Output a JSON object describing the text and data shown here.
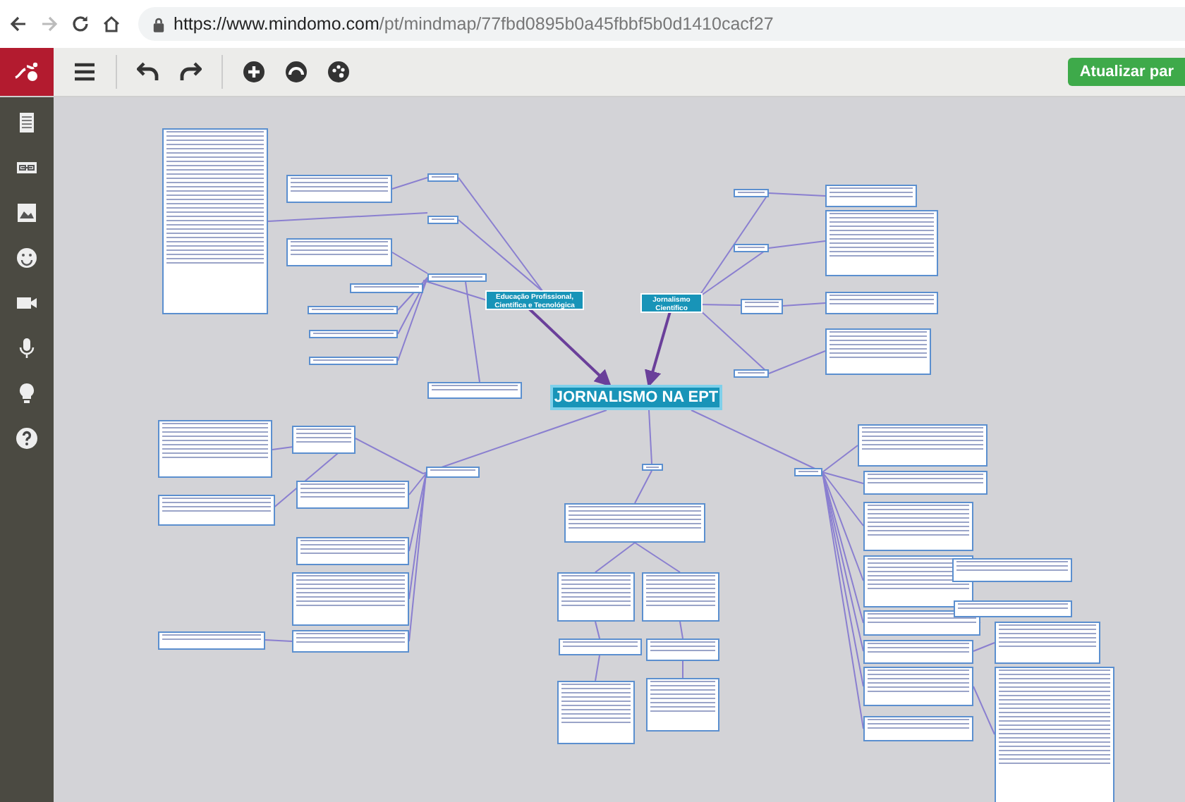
{
  "browser": {
    "url_host": "https://www.mindomo.com",
    "url_path": "/pt/mindmap/77fbd0895b0a45fbbf5b0d1410cacf27"
  },
  "toolbar": {
    "update_button": "Atualizar par"
  },
  "map": {
    "central": "JORNALISMO NA EPT",
    "topics": [
      {
        "label": "Educação Profissional, Científica e Tecnológica"
      },
      {
        "label": "Jornalismo Científico"
      }
    ]
  }
}
